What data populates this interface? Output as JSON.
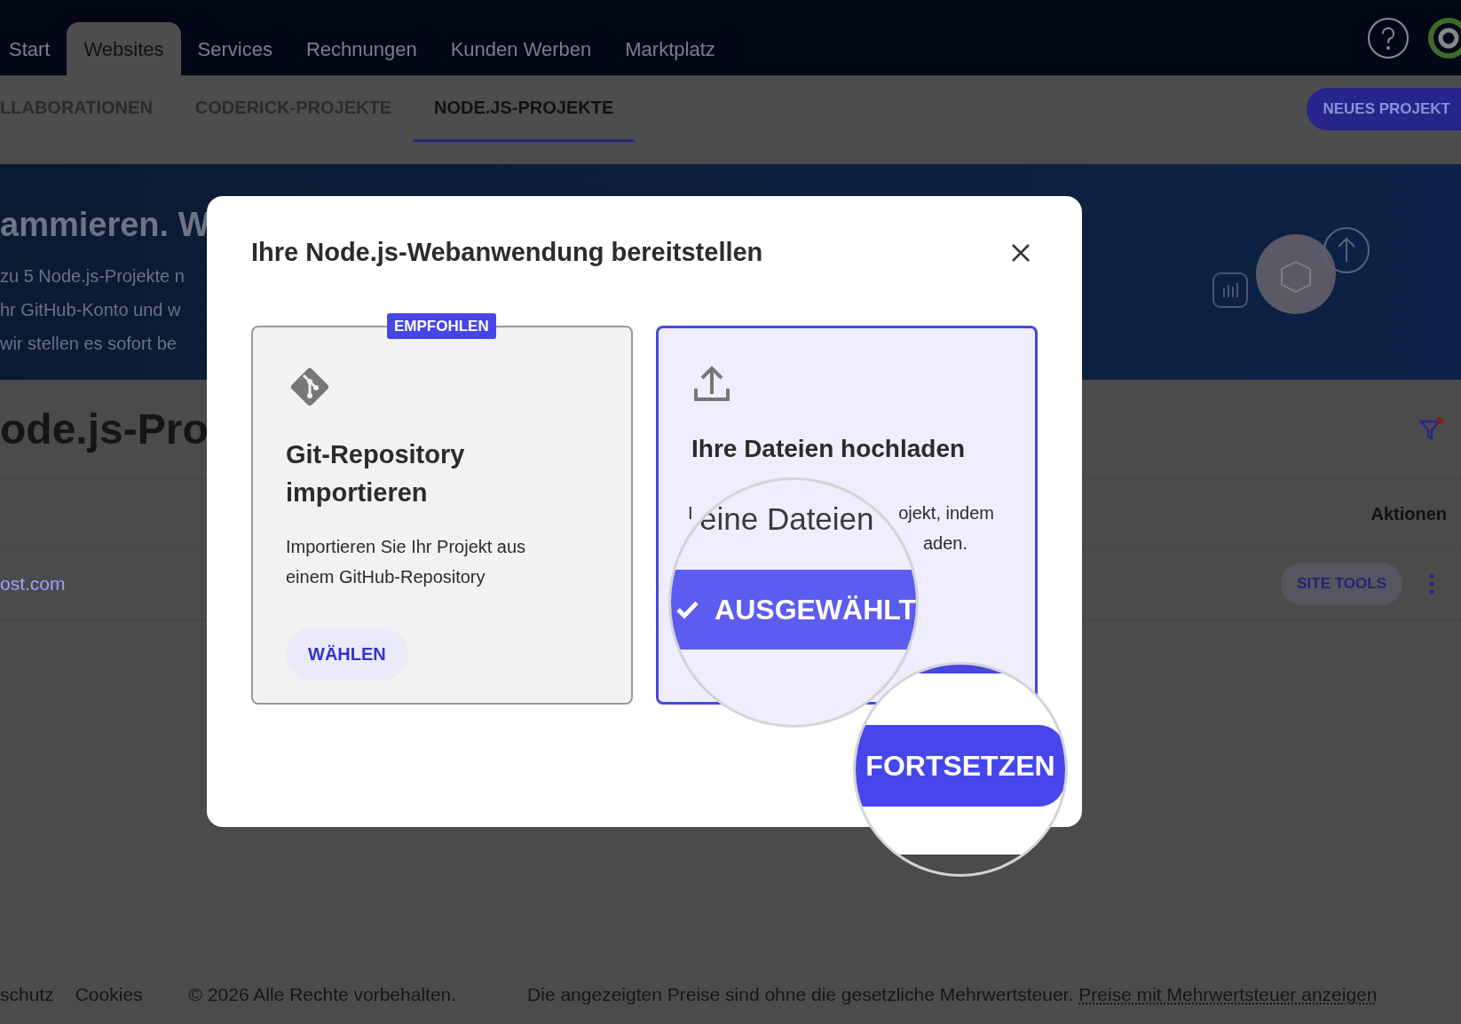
{
  "top_nav": {
    "tabs": [
      {
        "label": "Start",
        "selected": false
      },
      {
        "label": "Websites",
        "selected": true
      },
      {
        "label": "Services",
        "selected": false
      },
      {
        "label": "Rechnungen",
        "selected": false
      },
      {
        "label": "Kunden Werben",
        "selected": false
      },
      {
        "label": "Marktplatz",
        "selected": false
      }
    ]
  },
  "sub_nav": {
    "tabs": [
      {
        "label": "LLABORATIONEN",
        "selected": false
      },
      {
        "label": "CODERICK-PROJEKTE",
        "selected": false
      },
      {
        "label": "NODE.JS-PROJEKTE",
        "selected": true
      }
    ],
    "new_project_button": "NEUES PROJEKT"
  },
  "banner": {
    "heading": "ammieren. W",
    "lines": [
      "zu 5 Node.js-Projekte n",
      "hr GitHub-Konto und w",
      "wir stellen es sofort be"
    ]
  },
  "page": {
    "title": "ode.js-Pro",
    "table": {
      "columns": [
        "Aktionen"
      ],
      "rows": [
        {
          "domain": "ost.com",
          "action": "SITE TOOLS"
        }
      ]
    }
  },
  "footer": {
    "links": [
      "schutz",
      "Cookies"
    ],
    "copyright": "© 2026 Alle Rechte vorbehalten.",
    "note": "Die angezeigten Preise sind ohne die gesetzliche Mehrwertsteuer.",
    "vat_link": "Preise mit Mehrwertsteuer anzeigen"
  },
  "modal": {
    "title": "Ihre Node.js-Webanwendung bereitstellen",
    "options": [
      {
        "kind": "git",
        "badge": "EMPFOHLEN",
        "title": "Git-Repository importieren",
        "description": "Importieren Sie Ihr Projekt aus einem GitHub-Repository",
        "button": "WÄHLEN",
        "selected": false
      },
      {
        "kind": "upload",
        "title": "Ihre Dateien hochladen",
        "description_fragments": [
          "I",
          "ojekt, indem",
          "aden."
        ],
        "selected": true
      }
    ],
    "magnifier": {
      "text": "eine Dateien",
      "selected_label": "AUSGEWÄHLT",
      "continue_button": "FORTSETZEN"
    }
  }
}
